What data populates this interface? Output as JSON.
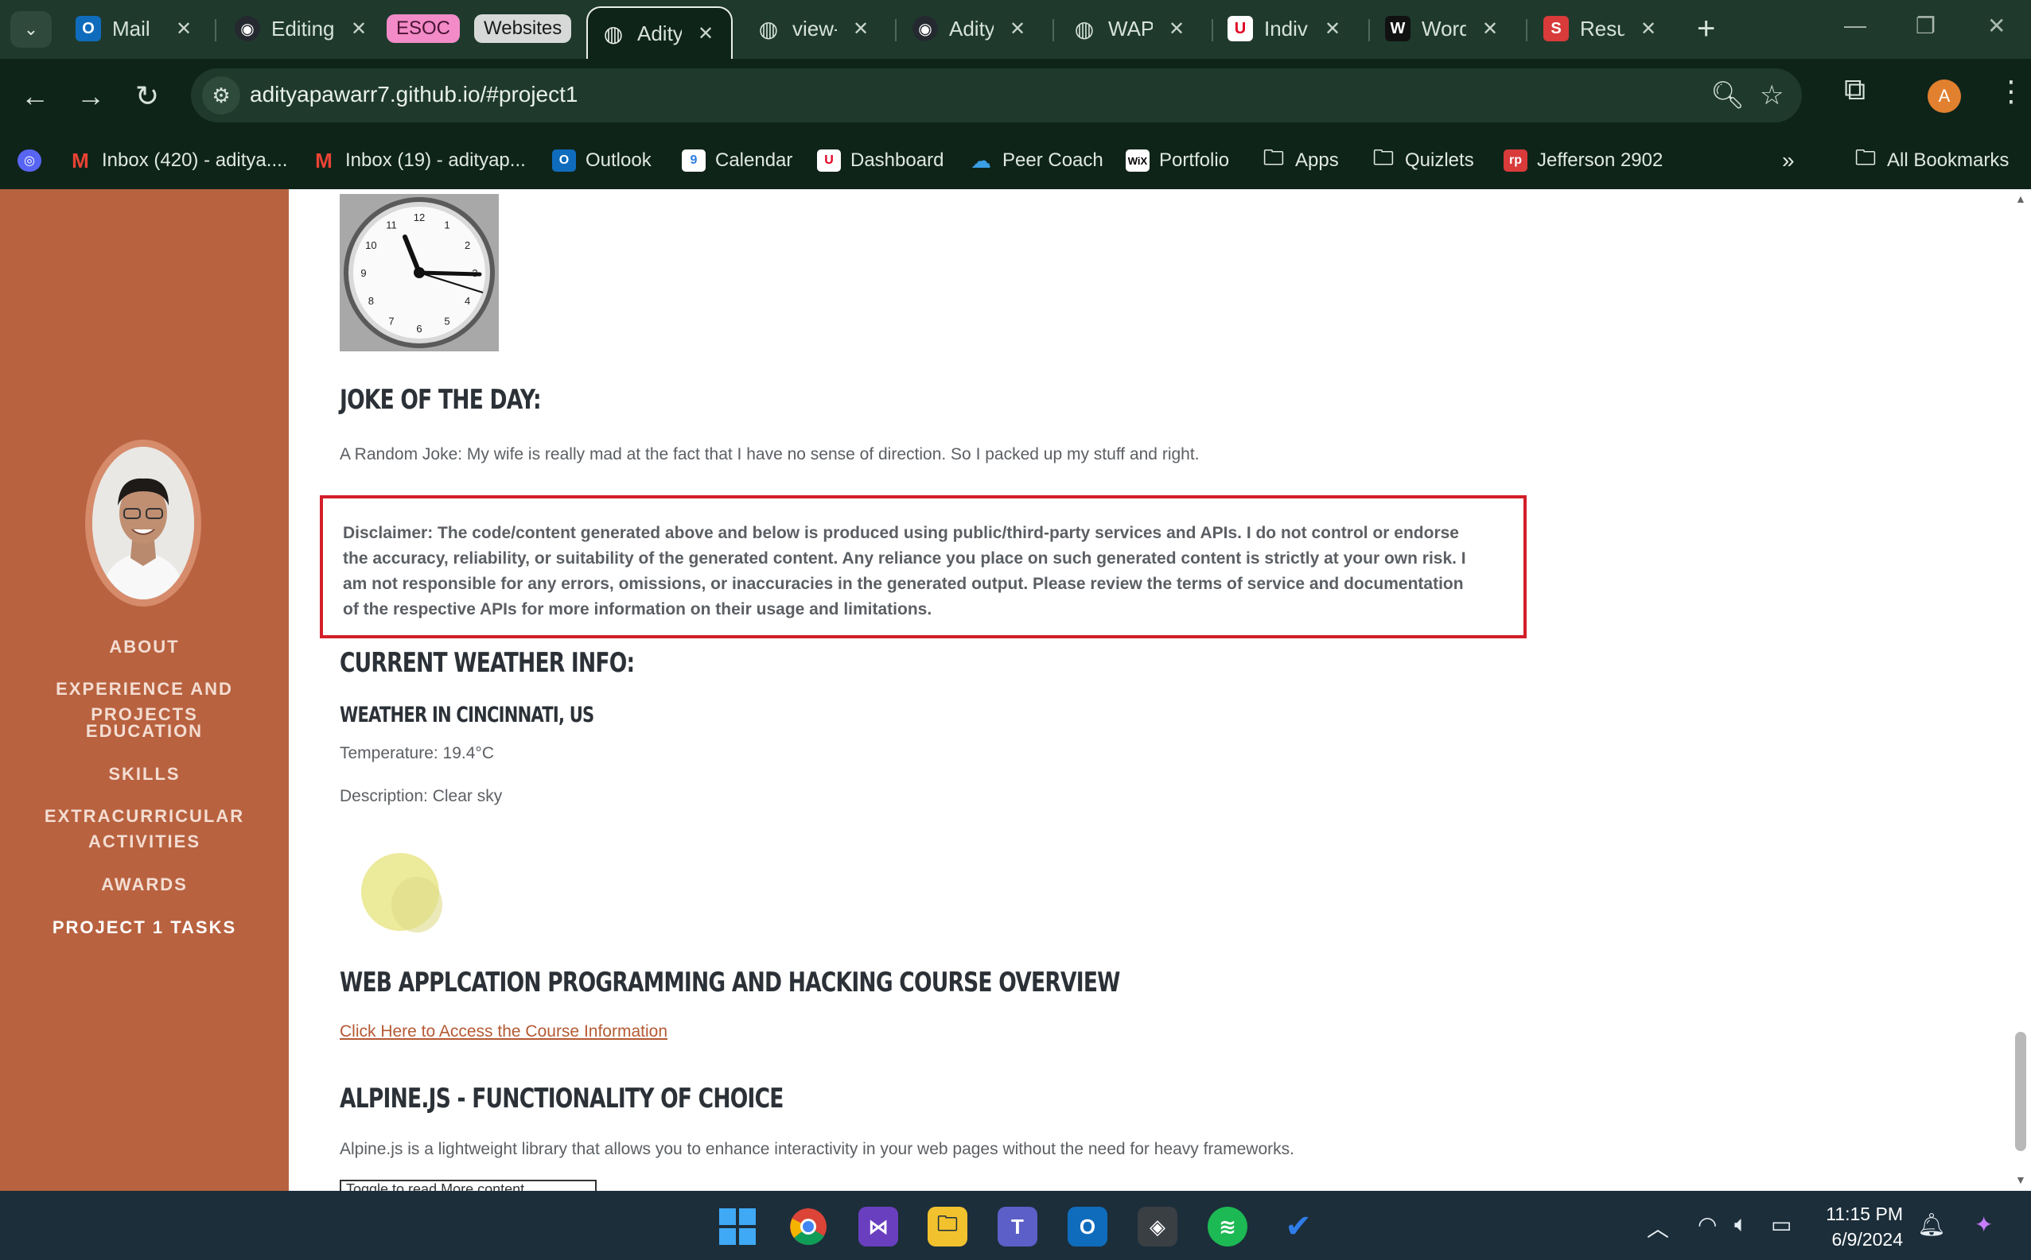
{
  "browser": {
    "tabs": [
      {
        "title": "Mail",
        "favicon": "outlook-icon",
        "color": "#0f6cbd",
        "glyph": "O"
      },
      {
        "title": "Editing",
        "favicon": "github-icon",
        "color": "#24292f",
        "glyph": "◉"
      },
      {
        "title": "Adity",
        "favicon": "globe-icon",
        "color": "#0f2419",
        "glyph": "🌐"
      },
      {
        "title": "view-",
        "favicon": "globe-icon",
        "color": "#3a5446",
        "glyph": "◍"
      },
      {
        "title": "Adity",
        "favicon": "github-icon",
        "color": "#24292f",
        "glyph": "◉"
      },
      {
        "title": "WAPI",
        "favicon": "globe-icon",
        "color": "#3a5446",
        "glyph": "◍"
      },
      {
        "title": "Indivi",
        "favicon": "uc-icon",
        "color": "#e00122",
        "glyph": "U"
      },
      {
        "title": "Word",
        "favicon": "w-icon",
        "color": "#111",
        "glyph": "W"
      },
      {
        "title": "Resur",
        "favicon": "s-icon",
        "color": "#d93a3a",
        "glyph": "S"
      }
    ],
    "tab_groups": {
      "esoc": "ESOC",
      "websites": "Websites"
    },
    "url": "adityapawarr7.github.io/#project1",
    "profile_initial": "A",
    "bookmarks": [
      {
        "label": "",
        "icon": "discord-icon",
        "color": "#5865f2",
        "glyph": "◎"
      },
      {
        "label": "Inbox (420) - aditya....",
        "icon": "gmail-icon",
        "color": "#0f2419",
        "glyph": "M"
      },
      {
        "label": "Inbox (19) - adityap...",
        "icon": "gmail-icon",
        "color": "#0f2419",
        "glyph": "M"
      },
      {
        "label": "Outlook",
        "icon": "outlook-icon",
        "color": "#0f6cbd",
        "glyph": "O"
      },
      {
        "label": "Calendar",
        "icon": "calendar-icon",
        "color": "#2a7de1",
        "glyph": "9"
      },
      {
        "label": "Dashboard",
        "icon": "uc-icon",
        "color": "#e00122",
        "glyph": "U"
      },
      {
        "label": "Peer Coach",
        "icon": "cloud-icon",
        "color": "#0f2419",
        "glyph": "☁"
      },
      {
        "label": "Portfolio",
        "icon": "wix-icon",
        "color": "#ffffff",
        "glyph": "WiX"
      },
      {
        "label": "Apps",
        "icon": "folder-icon",
        "color": "#0f2419",
        "glyph": "🗀"
      },
      {
        "label": "Quizlets",
        "icon": "folder-icon",
        "color": "#0f2419",
        "glyph": "🗀"
      },
      {
        "label": "Jefferson 2902",
        "icon": "rp-icon",
        "color": "#d93a3a",
        "glyph": "rp"
      }
    ],
    "all_bookmarks": "All Bookmarks"
  },
  "sidebar": {
    "nav": [
      "ABOUT",
      "EXPERIENCE AND PROJECTS",
      "EDUCATION",
      "SKILLS",
      "EXTRACURRICULAR",
      "ACTIVITIES",
      "AWARDS",
      "PROJECT 1 TASKS"
    ]
  },
  "content": {
    "clock_numbers": [
      "12",
      "1",
      "2",
      "3",
      "4",
      "5",
      "6",
      "7",
      "8",
      "9",
      "10",
      "11"
    ],
    "joke_heading": "JOKE OF THE DAY:",
    "joke_text": "A Random Joke: My wife is really mad at the fact that I have no sense of direction. So I packed up my stuff and right.",
    "disclaimer": [
      "Disclaimer: The code/content generated above and below is produced using public/third-party services and APIs. I do not control or endorse",
      "the accuracy, reliability, or suitability of the generated content. Any reliance you place on such generated content is strictly at your own risk. I",
      "am not responsible for any errors, omissions, or inaccuracies in the generated output. Please review the terms of service and documentation",
      "of the respective APIs for more information on their usage and limitations."
    ],
    "weather_heading": "CURRENT WEATHER INFO:",
    "weather_city": "WEATHER IN CINCINNATI, US",
    "temperature": "Temperature: 19.4°C",
    "description": "Description: Clear sky",
    "course_heading": "WEB APPLCATION PROGRAMMING AND HACKING COURSE OVERVIEW",
    "course_link": "Click Here to Access the Course Information",
    "alpine_heading": "ALPINE.JS - FUNCTIONALITY OF CHOICE",
    "alpine_text": "Alpine.js is a lightweight library that allows you to enhance interactivity in your web pages without the need for heavy frameworks.",
    "toggle_button": "Toggle to read More content"
  },
  "taskbar": {
    "time": "11:15 PM",
    "date": "6/9/2024"
  },
  "colors": {
    "sidebar": "#b86240",
    "disclaimer_border": "#d21f29",
    "link": "#b55a34"
  }
}
